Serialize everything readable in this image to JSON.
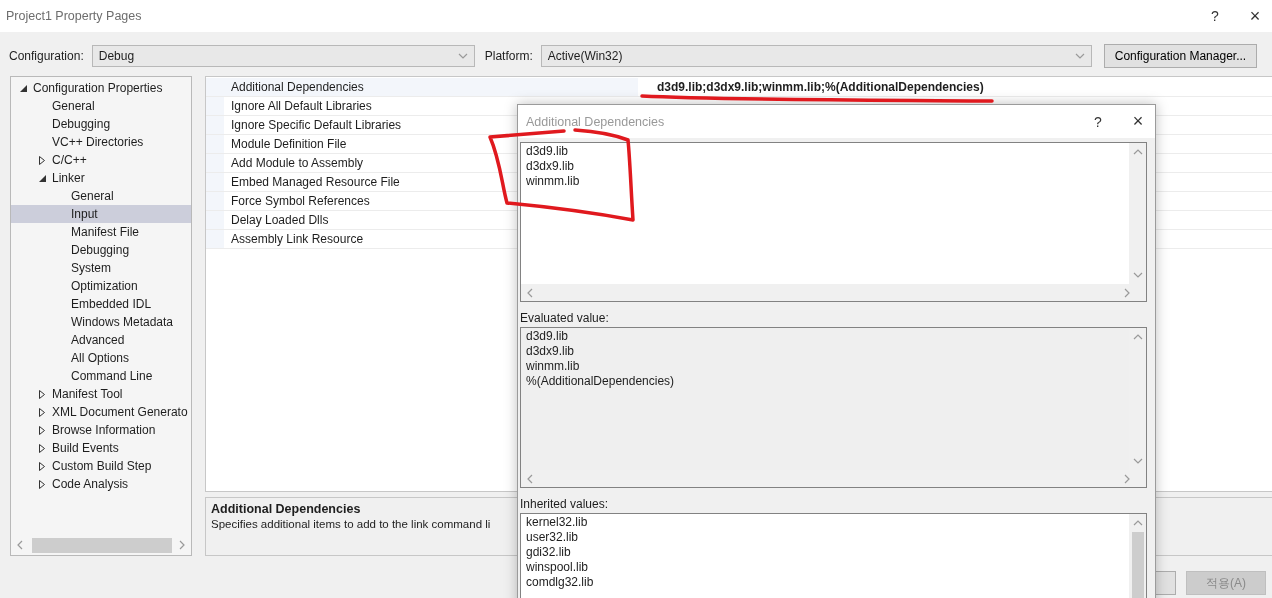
{
  "window": {
    "title": "Project1 Property Pages",
    "help": "?",
    "close": "×"
  },
  "configuration": {
    "label": "Configuration:",
    "value": "Debug"
  },
  "platform": {
    "label": "Platform:",
    "value": "Active(Win32)"
  },
  "configuration_manager": "Configuration Manager...",
  "tree": [
    {
      "label": "Configuration Properties",
      "expanded": true,
      "selected": false,
      "children": [
        {
          "label": "General",
          "selected": false
        },
        {
          "label": "Debugging",
          "selected": false
        },
        {
          "label": "VC++ Directories",
          "selected": false
        },
        {
          "label": "C/C++",
          "expanded": false,
          "selected": false
        },
        {
          "label": "Linker",
          "expanded": true,
          "selected": false,
          "children": [
            {
              "label": "General",
              "selected": false
            },
            {
              "label": "Input",
              "selected": true
            },
            {
              "label": "Manifest File",
              "selected": false
            },
            {
              "label": "Debugging",
              "selected": false
            },
            {
              "label": "System",
              "selected": false
            },
            {
              "label": "Optimization",
              "selected": false
            },
            {
              "label": "Embedded IDL",
              "selected": false
            },
            {
              "label": "Windows Metadata",
              "selected": false
            },
            {
              "label": "Advanced",
              "selected": false
            },
            {
              "label": "All Options",
              "selected": false
            },
            {
              "label": "Command Line",
              "selected": false
            }
          ]
        },
        {
          "label": "Manifest Tool",
          "expanded": false,
          "selected": false
        },
        {
          "label": "XML Document Generato",
          "expanded": false,
          "selected": false
        },
        {
          "label": "Browse Information",
          "expanded": false,
          "selected": false
        },
        {
          "label": "Build Events",
          "expanded": false,
          "selected": false
        },
        {
          "label": "Custom Build Step",
          "expanded": false,
          "selected": false
        },
        {
          "label": "Code Analysis",
          "expanded": false,
          "selected": false
        }
      ]
    }
  ],
  "properties": [
    {
      "name": "Additional Dependencies",
      "value": "d3d9.lib;d3dx9.lib;winmm.lib;%(AdditionalDependencies)",
      "selected": true
    },
    {
      "name": "Ignore All Default Libraries",
      "selected": false
    },
    {
      "name": "Ignore Specific Default Libraries",
      "selected": false
    },
    {
      "name": "Module Definition File",
      "selected": false
    },
    {
      "name": "Add Module to Assembly",
      "selected": false
    },
    {
      "name": "Embed Managed Resource File",
      "selected": false
    },
    {
      "name": "Force Symbol References",
      "selected": false
    },
    {
      "name": "Delay Loaded Dlls",
      "selected": false
    },
    {
      "name": "Assembly Link Resource",
      "selected": false
    }
  ],
  "description": {
    "title": "Additional Dependencies",
    "text": "Specifies additional items to add to the link command li"
  },
  "buttons": [
    {
      "disabled": false
    },
    {
      "label": "적용(A)",
      "disabled": true
    }
  ],
  "dialog": {
    "title": "Additional Dependencies",
    "help": "?",
    "close": "×",
    "lines": [
      "d3d9.lib",
      "d3dx9.lib",
      "winmm.lib"
    ],
    "evaluated_label": "Evaluated value:",
    "evaluated": [
      "d3d9.lib",
      "d3dx9.lib",
      "winmm.lib",
      "%(AdditionalDependencies)"
    ],
    "inherited_label": "Inherited values:",
    "inherited": [
      "kernel32.lib",
      "user32.lib",
      "gdi32.lib",
      "winspool.lib",
      "comdlg32.lib"
    ]
  }
}
